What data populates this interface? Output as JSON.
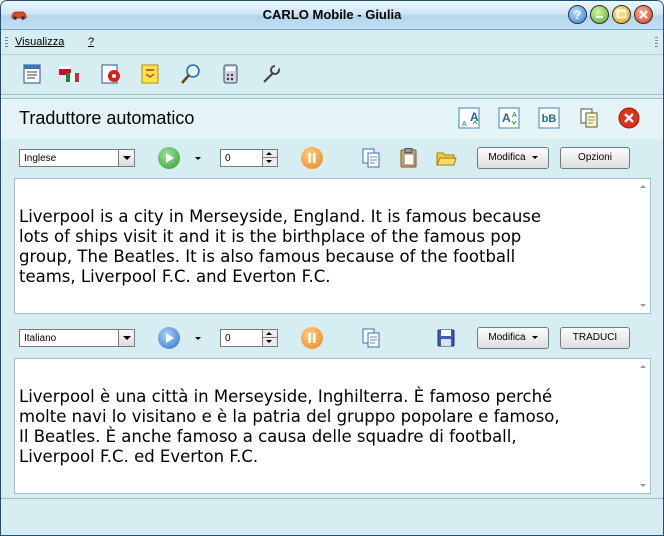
{
  "window": {
    "title": "CARLO Mobile - Giulia"
  },
  "menu": {
    "items": [
      "Visualizza",
      "?"
    ]
  },
  "toolbar": {
    "icons": [
      "document-icon",
      "flags-icon",
      "audio-icon",
      "dictionary-icon",
      "search-icon",
      "calculator-icon",
      "wrench-icon"
    ]
  },
  "panel": {
    "title": "Traduttore automatico",
    "header_icons": [
      "font-increase-icon",
      "font-decrease-icon",
      "case-icon",
      "copy-pages-icon",
      "close-icon"
    ]
  },
  "source": {
    "language": "Inglese",
    "speed": "0",
    "modify_label": "Modifica",
    "options_label": "Opzioni",
    "text": "Liverpool is a city in Merseyside, England. It is famous because\nlots of ships visit it and it is the birthplace of the famous pop\ngroup, The Beatles. It is also famous because of the football\nteams, Liverpool F.C. and Everton F.C."
  },
  "target": {
    "language": "Italiano",
    "speed": "0",
    "modify_label": "Modifica",
    "translate_label": "TRADUCI",
    "text": "Liverpool è una città in Merseyside, Inghilterra. È famoso perché\nmolte navi lo visitano e è la patria del gruppo popolare e famoso,\nIl Beatles. È anche famoso a causa delle squadre di football,\nLiverpool F.C. ed Everton F.C."
  },
  "colors": {
    "play_source": "#3ca43c",
    "play_target": "#2f76c8",
    "pause": "#f08a1c",
    "close": "#e0301e",
    "frame": "#d6eef1"
  }
}
